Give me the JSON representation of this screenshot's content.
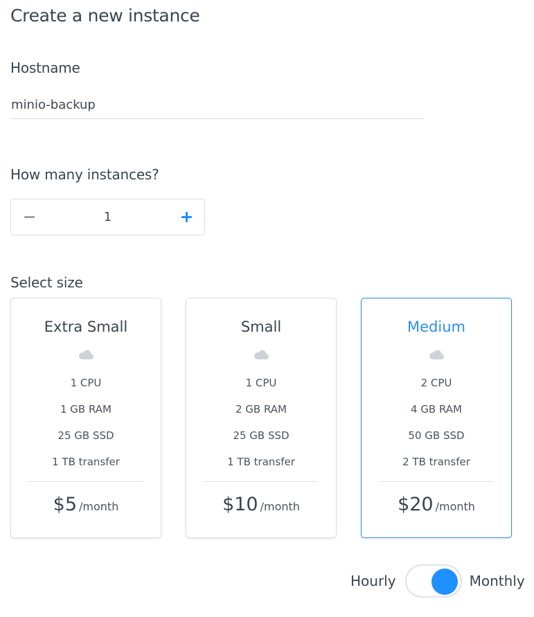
{
  "page": {
    "title": "Create a new instance"
  },
  "hostname": {
    "label": "Hostname",
    "value": "minio-backup"
  },
  "instances": {
    "label": "How many instances?",
    "count": "1"
  },
  "size": {
    "label": "Select size",
    "selected": "Medium",
    "options": [
      {
        "name": "Extra Small",
        "cpu": "1 CPU",
        "ram": "1 GB RAM",
        "ssd": "25 GB SSD",
        "transfer": "1 TB transfer",
        "price": "$5",
        "period": "/month"
      },
      {
        "name": "Small",
        "cpu": "1 CPU",
        "ram": "2 GB RAM",
        "ssd": "25 GB SSD",
        "transfer": "1 TB transfer",
        "price": "$10",
        "period": "/month"
      },
      {
        "name": "Medium",
        "cpu": "2 CPU",
        "ram": "4 GB RAM",
        "ssd": "50 GB SSD",
        "transfer": "2 TB transfer",
        "price": "$20",
        "period": "/month"
      }
    ]
  },
  "billing": {
    "left_label": "Hourly",
    "right_label": "Monthly",
    "selected": "Monthly"
  },
  "icons": {
    "decrement": "minus-icon",
    "increment": "plus-icon",
    "size": "cloud-icon"
  },
  "colors": {
    "accent": "#1e90ff",
    "text": "#3a4550",
    "border": "#dcdfe3",
    "muted_icon": "#cfd3d7"
  }
}
